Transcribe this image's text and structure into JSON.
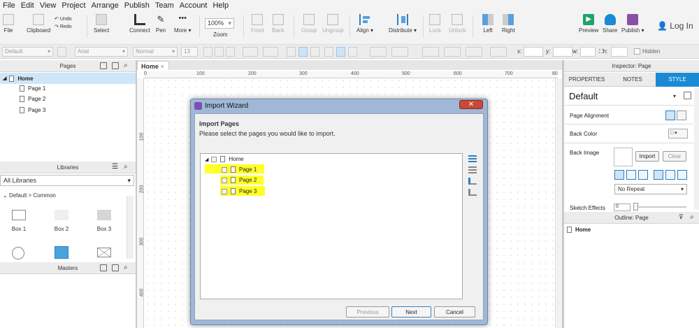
{
  "menu": [
    "File",
    "Edit",
    "View",
    "Project",
    "Arrange",
    "Publish",
    "Team",
    "Account",
    "Help"
  ],
  "toolbar": {
    "file": "File",
    "clipboard": "Clipboard",
    "undo": "Undo",
    "redo": "Redo",
    "select": "Select",
    "connect": "Connect",
    "pen": "Pen",
    "more": "More ▾",
    "zoom_value": "100%",
    "zoom": "Zoom",
    "front": "Front",
    "back": "Back",
    "group": "Group",
    "ungroup": "Ungroup",
    "align": "Align ▾",
    "distribute": "Distribute ▾",
    "lock": "Lock",
    "unlock": "Unlock",
    "left": "Left",
    "right": "Right",
    "preview": "Preview",
    "share": "Share",
    "publish": "Publish ▾",
    "login": "Log In"
  },
  "format": {
    "style": "Default",
    "font": "Arial",
    "weight": "Normal",
    "size": "13",
    "x": "x:",
    "y": "y:",
    "w": "w:",
    "h": "h:",
    "hidden": "Hidden"
  },
  "pages_panel": {
    "title": "Pages",
    "items": [
      {
        "label": "Home"
      },
      {
        "label": "Page 1"
      },
      {
        "label": "Page 2"
      },
      {
        "label": "Page 3"
      }
    ]
  },
  "libraries_panel": {
    "title": "Libraries",
    "dropdown": "All Libraries",
    "group": "Default > Common",
    "items": [
      "Box 1",
      "Box 2",
      "Box 3"
    ]
  },
  "masters_panel": {
    "title": "Masters"
  },
  "canvas": {
    "tab": "Home",
    "ruler_h": [
      "0",
      "100",
      "200",
      "300",
      "400",
      "500",
      "600",
      "700",
      "80"
    ],
    "ruler_v": [
      "100",
      "200",
      "300",
      "400"
    ]
  },
  "dialog": {
    "title": "Import Wizard",
    "heading": "Import Pages",
    "description": "Please select the pages you would like to import.",
    "tree": [
      {
        "label": "Home"
      },
      {
        "label": "Page 1"
      },
      {
        "label": "Page 2"
      },
      {
        "label": "Page 3"
      }
    ],
    "previous": "Previous",
    "next": "Next",
    "cancel": "Cancel",
    "highlight_color": "#ffff2a"
  },
  "inspector": {
    "title": "Inspector: Page",
    "tabs": [
      "PROPERTIES",
      "NOTES",
      "STYLE"
    ],
    "style_name": "Default",
    "page_alignment": "Page Alignment",
    "back_color": "Back Color",
    "back_image": "Back Image",
    "import": "Import",
    "clear": "Clear",
    "repeat": "No Repeat",
    "sketch": "Sketch Effects",
    "sketch_value": "0",
    "accent": "#1a8ad4"
  },
  "outline": {
    "title": "Outline: Page",
    "root": "Home"
  }
}
